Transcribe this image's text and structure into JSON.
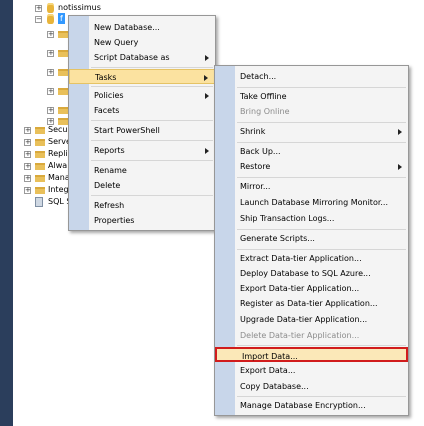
{
  "tree": {
    "database_name": "notissimus",
    "selected_label": "f",
    "nodes": [
      "Secur",
      "Serve",
      "Repli",
      "Alwa",
      "Mana",
      "Integ",
      "SQL S"
    ]
  },
  "context_menu": {
    "new_database": "New Database...",
    "new_query": "New Query",
    "script_database_as": "Script Database as",
    "tasks": "Tasks",
    "policies": "Policies",
    "facets": "Facets",
    "start_powershell": "Start PowerShell",
    "reports": "Reports",
    "rename": "Rename",
    "delete": "Delete",
    "refresh": "Refresh",
    "properties": "Properties"
  },
  "tasks_menu": {
    "detach": "Detach...",
    "take_offline": "Take Offline",
    "bring_online": "Bring Online",
    "shrink": "Shrink",
    "back_up": "Back Up...",
    "restore": "Restore",
    "mirror": "Mirror...",
    "launch_mirroring_monitor": "Launch Database Mirroring Monitor...",
    "ship_transaction_logs": "Ship Transaction Logs...",
    "generate_scripts": "Generate Scripts...",
    "extract_dac": "Extract Data-tier Application...",
    "deploy_sql_azure": "Deploy Database to SQL Azure...",
    "export_dac": "Export Data-tier Application...",
    "register_dac": "Register as Data-tier Application...",
    "upgrade_dac": "Upgrade Data-tier Application...",
    "delete_dac": "Delete Data-tier Application...",
    "import_data": "Import Data...",
    "export_data": "Export Data...",
    "copy_database": "Copy Database...",
    "manage_encryption": "Manage Database Encryption..."
  },
  "colors": {
    "highlight_border": "#d11c1c",
    "hover_background": "#fbe2a0",
    "gutter": "#c8d6ea"
  }
}
